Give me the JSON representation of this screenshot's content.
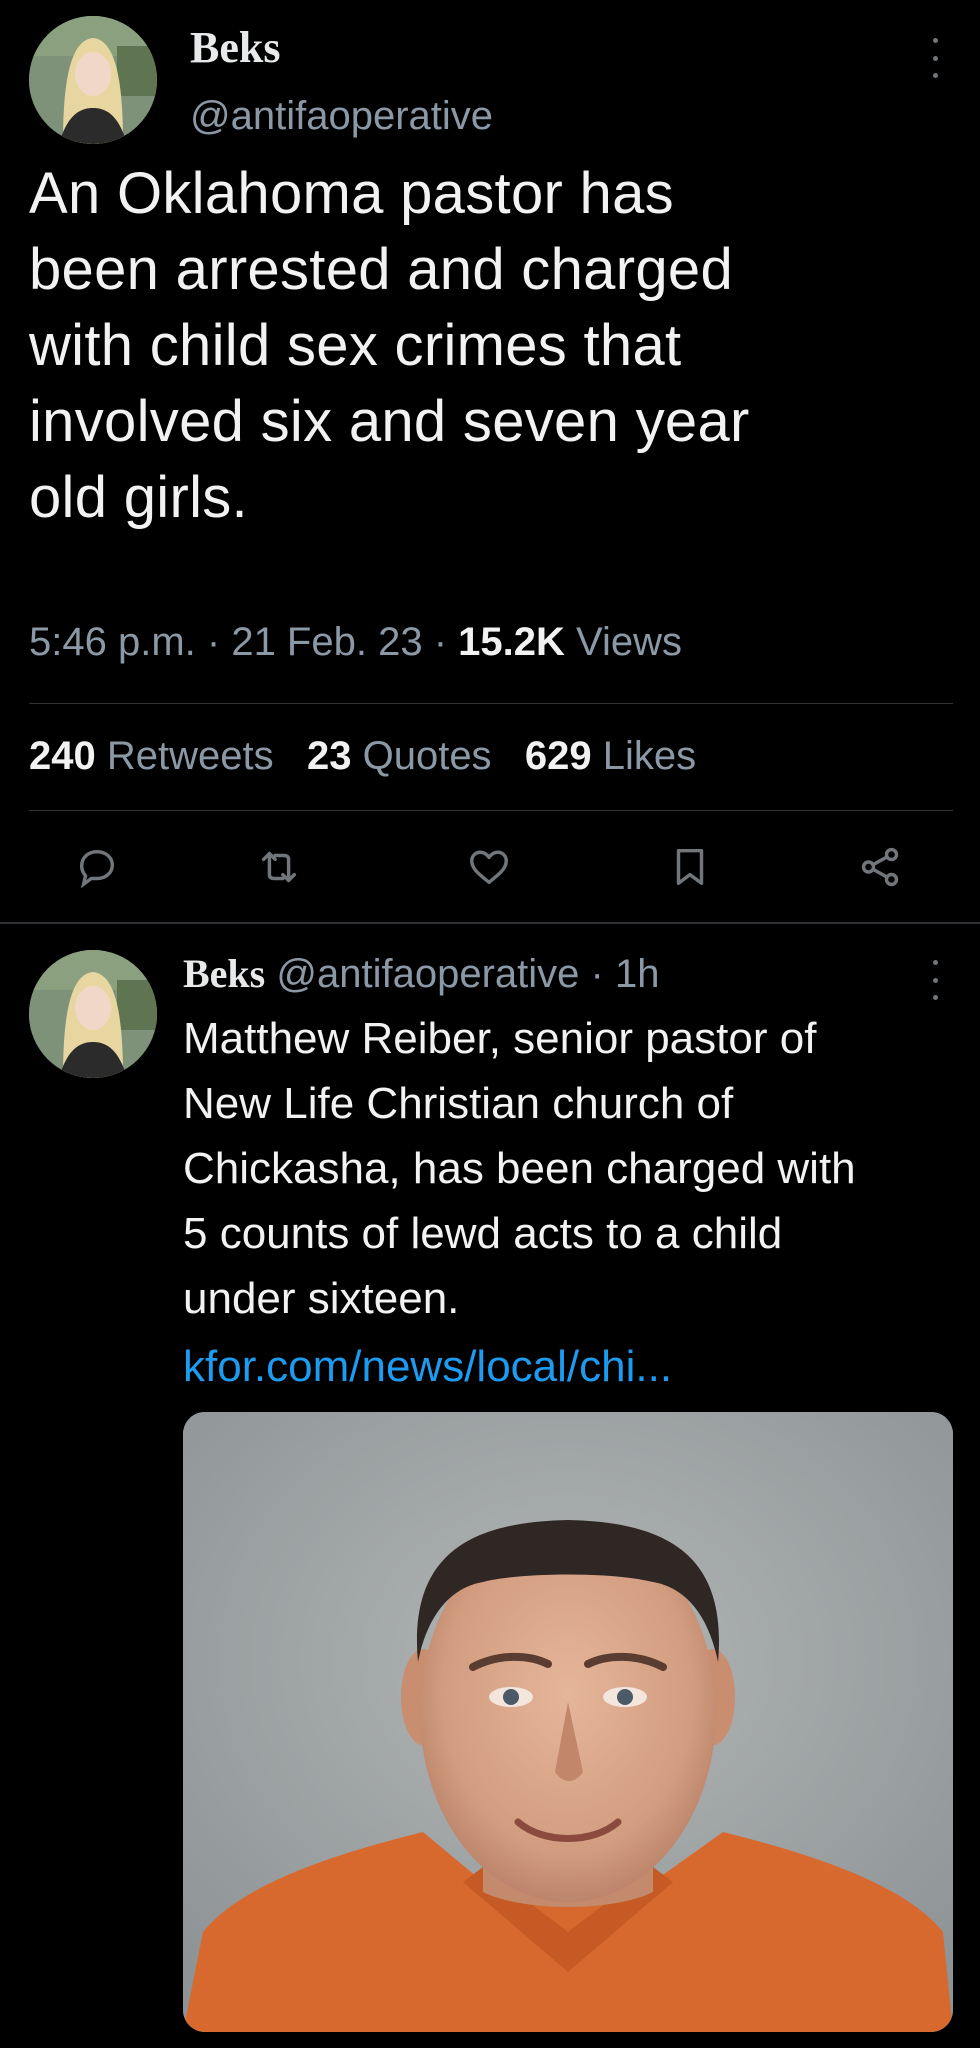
{
  "main_tweet": {
    "author_name": "Beks",
    "author_handle": "@antifaoperative",
    "text_lines": [
      "An Oklahoma pastor has",
      "been arrested and charged",
      "with child sex crimes that",
      "involved six and seven year",
      "old girls."
    ],
    "time": "5:46 p.m.",
    "date": "21 Feb. 23",
    "views_count": "15.2K",
    "views_label": "Views",
    "retweets_count": "240",
    "retweets_label": "Retweets",
    "quotes_count": "23",
    "quotes_label": "Quotes",
    "likes_count": "629",
    "likes_label": "Likes",
    "actions": [
      "reply-icon",
      "retweet-icon",
      "like-icon",
      "bookmark-icon",
      "share-icon"
    ]
  },
  "reply_tweet": {
    "author_name": "Beks",
    "author_handle": "@antifaoperative",
    "age": "1h",
    "text_lines": [
      "Matthew Reiber, senior pastor of",
      "New Life Christian church of",
      "Chickasha, has been charged with",
      "5 counts of lewd acts to a child",
      "under sixteen."
    ],
    "link_text": "kfor.com/news/local/chi..."
  },
  "colors": {
    "background": "#000000",
    "text": "#e7e9ea",
    "secondary": "#8b98a5",
    "link": "#1d9bf0",
    "divider": "#2f3336"
  }
}
